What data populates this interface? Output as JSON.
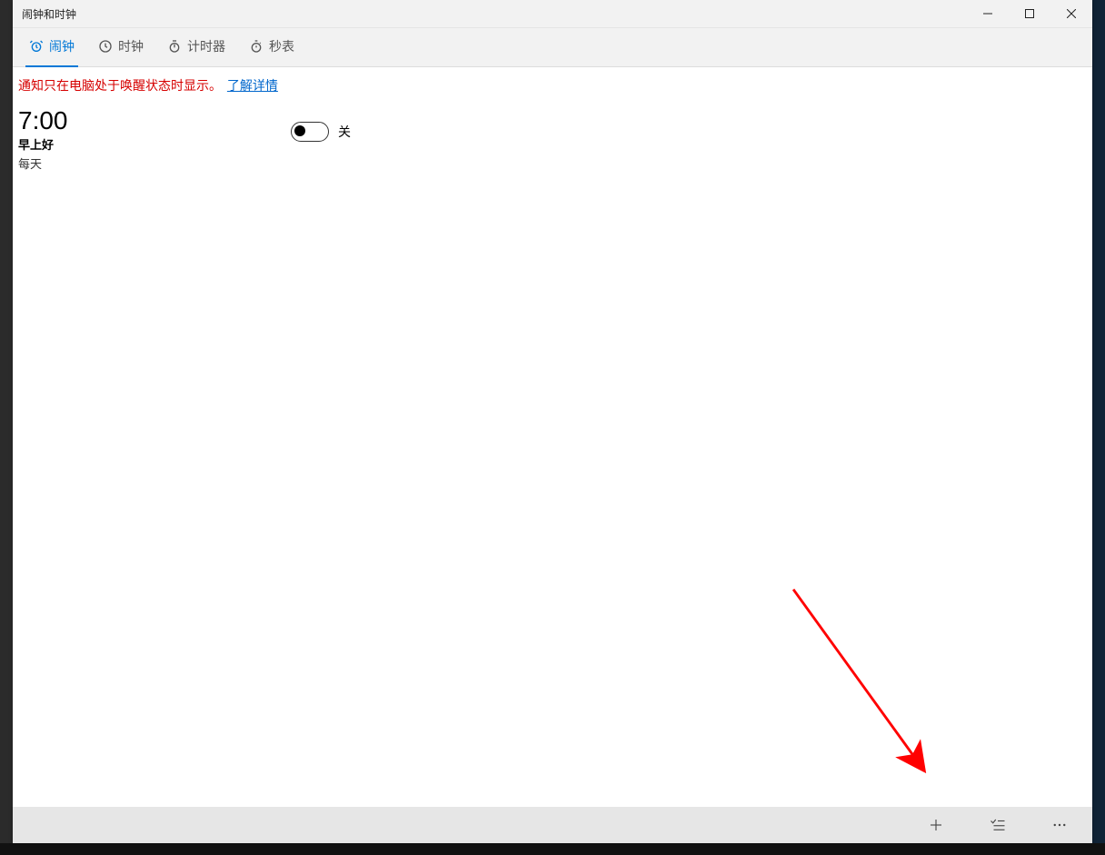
{
  "window": {
    "title": "闹钟和时钟"
  },
  "tabs": [
    {
      "label": "闹钟",
      "icon": "alarm",
      "active": true
    },
    {
      "label": "时钟",
      "icon": "clock",
      "active": false
    },
    {
      "label": "计时器",
      "icon": "timer",
      "active": false
    },
    {
      "label": "秒表",
      "icon": "stopwatch",
      "active": false
    }
  ],
  "notification": {
    "warning": "通知只在电脑处于唤醒状态时显示。",
    "link": "了解详情"
  },
  "alarms": [
    {
      "time": "7:00",
      "name": "早上好",
      "repeat": "每天",
      "state_label": "关",
      "enabled": false
    }
  ],
  "colors": {
    "accent": "#0078d7",
    "warning": "#d60000",
    "link": "#0066cc"
  }
}
